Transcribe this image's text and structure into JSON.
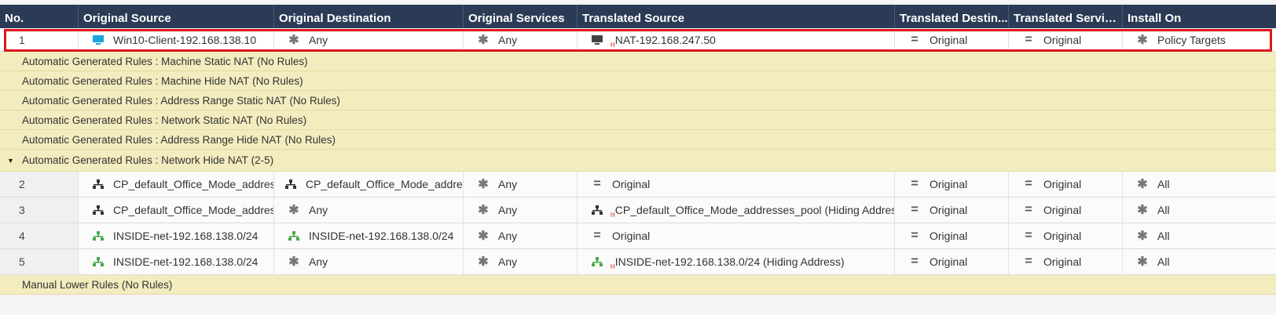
{
  "columns": [
    "No.",
    "Original Source",
    "Original Destination",
    "Original Services",
    "Translated Source",
    "Translated Destin...",
    "Translated Services",
    "Install On"
  ],
  "colors": {
    "header_bg": "#2b3b56",
    "section_bg": "#f3ecbf",
    "selection_border": "#e0161f",
    "host_icon": "#1aa6e0",
    "network_icon_green": "#48a94a"
  },
  "row1": {
    "no": "1",
    "orig_source": "Win10-Client-192.168.138.10",
    "orig_dest": "Any",
    "orig_services": "Any",
    "trans_source": "NAT-192.168.247.50",
    "trans_dest": "Original",
    "trans_services": "Original",
    "install_on": "Policy Targets",
    "hide_marker": "H"
  },
  "sections": {
    "s1": "Automatic Generated Rules : Machine Static NAT",
    "s1_count": "(No Rules)",
    "s2": "Automatic Generated Rules : Machine Hide NAT",
    "s2_count": "(No Rules)",
    "s3": "Automatic Generated Rules : Address Range Static NAT",
    "s3_count": "(No Rules)",
    "s4": "Automatic Generated Rules : Network Static NAT",
    "s4_count": "(No Rules)",
    "s5": "Automatic Generated Rules : Address Range Hide NAT",
    "s5_count": "(No Rules)",
    "s6": "Automatic Generated Rules : Network Hide NAT",
    "s6_count": "(2-5)",
    "s7": "Manual Lower Rules",
    "s7_count": "(No Rules)"
  },
  "row2": {
    "no": "2",
    "orig_source": "CP_default_Office_Mode_address...",
    "orig_dest": "CP_default_Office_Mode_addresse",
    "orig_services": "Any",
    "trans_source": "Original",
    "trans_dest": "Original",
    "trans_services": "Original",
    "install_on": "All"
  },
  "row3": {
    "no": "3",
    "orig_source": "CP_default_Office_Mode_address...",
    "orig_dest": "Any",
    "orig_services": "Any",
    "trans_source": "CP_default_Office_Mode_addresses_pool",
    "trans_source_note": "(Hiding Address)",
    "trans_dest": "Original",
    "trans_services": "Original",
    "install_on": "All",
    "hide_marker": "H"
  },
  "row4": {
    "no": "4",
    "orig_source": "INSIDE-net-192.168.138.0/24",
    "orig_dest": "INSIDE-net-192.168.138.0/24",
    "orig_services": "Any",
    "trans_source": "Original",
    "trans_dest": "Original",
    "trans_services": "Original",
    "install_on": "All"
  },
  "row5": {
    "no": "5",
    "orig_source": "INSIDE-net-192.168.138.0/24",
    "orig_dest": "Any",
    "orig_services": "Any",
    "trans_source": "INSIDE-net-192.168.138.0/24",
    "trans_source_note": "(Hiding Address)",
    "trans_dest": "Original",
    "trans_services": "Original",
    "install_on": "All",
    "hide_marker": "H"
  }
}
